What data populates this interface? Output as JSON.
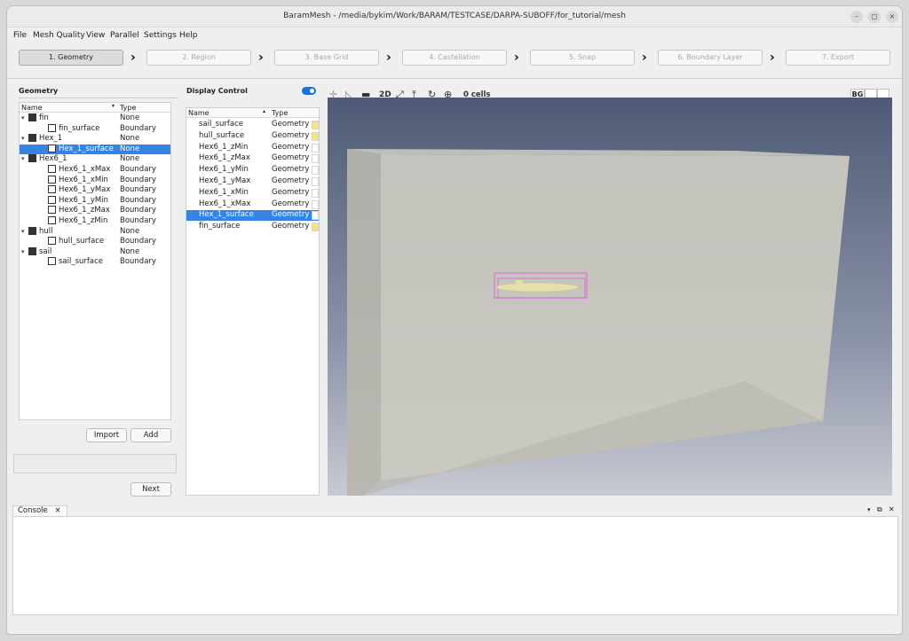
{
  "window": {
    "title": "BaramMesh - /media/bykim/Work/BARAM/TESTCASE/DARPA-SUBOFF/for_tutorial/mesh",
    "minimize_label": "–",
    "maximize_label": "◻",
    "close_label": "×"
  },
  "menu": [
    "File",
    "Mesh Quality",
    "View",
    "Parallel",
    "Settings",
    "Help"
  ],
  "steps": [
    "1. Geometry",
    "2. Region",
    "3. Base Grid",
    "4. Castellation",
    "5. Snap",
    "6. Boundary Layer",
    "7. Export"
  ],
  "geometry_panel": {
    "title": "Geometry",
    "col_name": "Name",
    "col_type": "Type",
    "rows": [
      {
        "name": "fin",
        "type": "None",
        "level": 0,
        "kind": "solid",
        "expanded": true
      },
      {
        "name": "fin_surface",
        "type": "Boundary",
        "level": 1,
        "kind": "surface"
      },
      {
        "name": "Hex_1",
        "type": "None",
        "level": 0,
        "kind": "solid",
        "expanded": true
      },
      {
        "name": "Hex_1_surface",
        "type": "None",
        "level": 1,
        "kind": "surface",
        "selected": true
      },
      {
        "name": "Hex6_1",
        "type": "None",
        "level": 0,
        "kind": "solid",
        "expanded": true
      },
      {
        "name": "Hex6_1_xMax",
        "type": "Boundary",
        "level": 1,
        "kind": "surface"
      },
      {
        "name": "Hex6_1_xMin",
        "type": "Boundary",
        "level": 1,
        "kind": "surface"
      },
      {
        "name": "Hex6_1_yMax",
        "type": "Boundary",
        "level": 1,
        "kind": "surface"
      },
      {
        "name": "Hex6_1_yMin",
        "type": "Boundary",
        "level": 1,
        "kind": "surface"
      },
      {
        "name": "Hex6_1_zMax",
        "type": "Boundary",
        "level": 1,
        "kind": "surface"
      },
      {
        "name": "Hex6_1_zMin",
        "type": "Boundary",
        "level": 1,
        "kind": "surface"
      },
      {
        "name": "hull",
        "type": "None",
        "level": 0,
        "kind": "solid",
        "expanded": true
      },
      {
        "name": "hull_surface",
        "type": "Boundary",
        "level": 1,
        "kind": "surface"
      },
      {
        "name": "sail",
        "type": "None",
        "level": 0,
        "kind": "solid",
        "expanded": true
      },
      {
        "name": "sail_surface",
        "type": "Boundary",
        "level": 1,
        "kind": "surface"
      }
    ],
    "import_label": "Import",
    "add_label": "Add",
    "next_label": "Next"
  },
  "display_control": {
    "title": "Display Control",
    "col_name": "Name",
    "col_type": "Type",
    "rows": [
      {
        "name": "sail_surface",
        "type": "Geometry",
        "color": "#f5e57a"
      },
      {
        "name": "hull_surface",
        "type": "Geometry",
        "color": "#f5e57a"
      },
      {
        "name": "Hex6_1_zMin",
        "type": "Geometry",
        "color": "#ffffff"
      },
      {
        "name": "Hex6_1_zMax",
        "type": "Geometry",
        "color": "#ffffff"
      },
      {
        "name": "Hex6_1_yMin",
        "type": "Geometry",
        "color": "#ffffff"
      },
      {
        "name": "Hex6_1_yMax",
        "type": "Geometry",
        "color": "#ffffff"
      },
      {
        "name": "Hex6_1_xMin",
        "type": "Geometry",
        "color": "#ffffff"
      },
      {
        "name": "Hex6_1_xMax",
        "type": "Geometry",
        "color": "#ffffff"
      },
      {
        "name": "Hex_1_surface",
        "type": "Geometry",
        "color": "#ffffff",
        "selected": true
      },
      {
        "name": "fin_surface",
        "type": "Geometry",
        "color": "#f5e57a"
      }
    ]
  },
  "view_toolbar": {
    "mode_2d": "2D",
    "cells": "0 cells",
    "bg": "BG"
  },
  "console": {
    "tab_label": "Console",
    "close_label": "×"
  },
  "colors": {
    "selection": "#3584e4",
    "accent": "#1c71d8"
  }
}
